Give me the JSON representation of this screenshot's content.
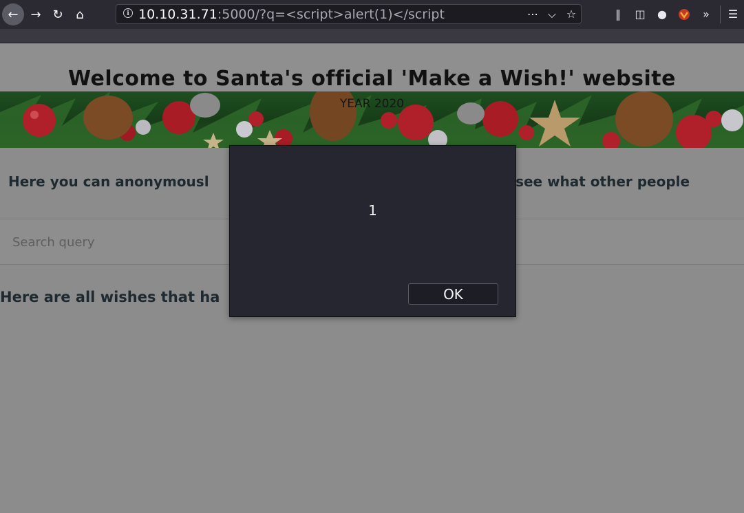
{
  "browser": {
    "url_host": "10.10.31.71",
    "url_rest": ":5000/?q=<script>alert(1)</script",
    "icons": [
      "back-arrow-icon",
      "forward-arrow-icon",
      "reload-icon",
      "home-icon",
      "info-icon",
      "more-dots-icon",
      "pocket-icon",
      "star-icon",
      "library-icon",
      "sidebar-icon",
      "account-icon",
      "extension-icon",
      "overflow-chevron-icon",
      "menu-icon"
    ]
  },
  "page": {
    "title": "Welcome to Santa's official 'Make a Wish!' website",
    "subtitle": "YEAR 2020",
    "intro_left": "Here you can anonymousl",
    "intro_right": "nd see what other people",
    "search_placeholder": "Search query",
    "wishes_heading": "Here are all wishes that ha"
  },
  "dialog": {
    "message": "1",
    "ok_label": "OK"
  },
  "colors": {
    "overlay": "#8c8c8c",
    "dialog_bg": "#25262f",
    "chrome_bg": "#2b2a33",
    "ornament_red": "#b0202a"
  }
}
